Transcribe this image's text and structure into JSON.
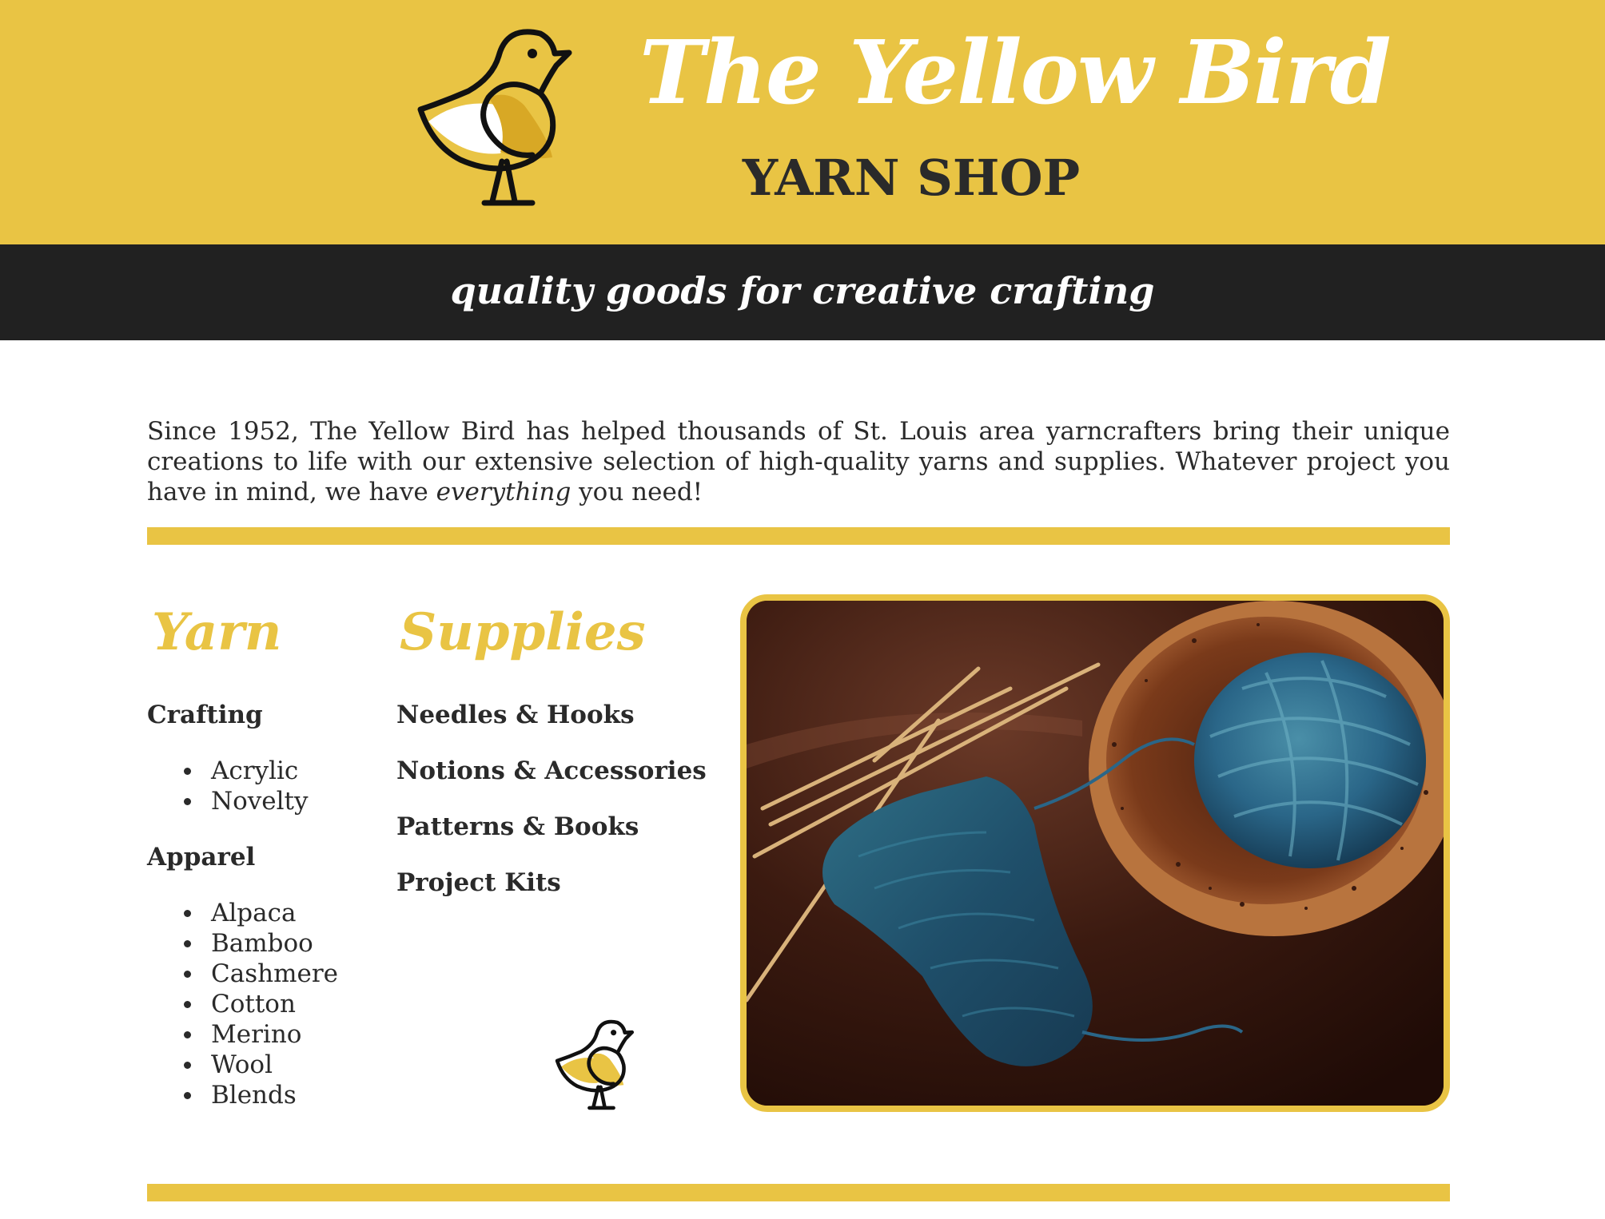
{
  "header": {
    "title": "The Yellow Bird",
    "subtitle": "YARN SHOP",
    "logo_icon": "yellow-bird-logo-icon"
  },
  "tagline": "quality goods for creative crafting",
  "intro": {
    "text_before": "Since 1952, The Yellow Bird has helped thousands of St. Louis area yarncrafters bring their unique creations to life with our extensive selection of high-quality yarns and supplies. Whatever project you have in mind, we have ",
    "emphasis": "everything",
    "text_after": " you need!"
  },
  "yarn": {
    "heading": "Yarn",
    "groups": [
      {
        "label": "Crafting",
        "items": [
          "Acrylic",
          "Novelty"
        ]
      },
      {
        "label": "Apparel",
        "items": [
          "Alpaca",
          "Bamboo",
          "Cashmere",
          "Cotton",
          "Merino",
          "Wool",
          "Blends"
        ]
      }
    ]
  },
  "supplies": {
    "heading": "Supplies",
    "items": [
      "Needles & Hooks",
      "Notions & Accessories",
      "Patterns & Books",
      "Project Kits"
    ]
  },
  "photo": {
    "subject": "knitting-project-photo"
  },
  "colors": {
    "brand_yellow": "#e9c444",
    "dark_band": "#212121",
    "text": "#2a2a2a",
    "white": "#ffffff"
  }
}
